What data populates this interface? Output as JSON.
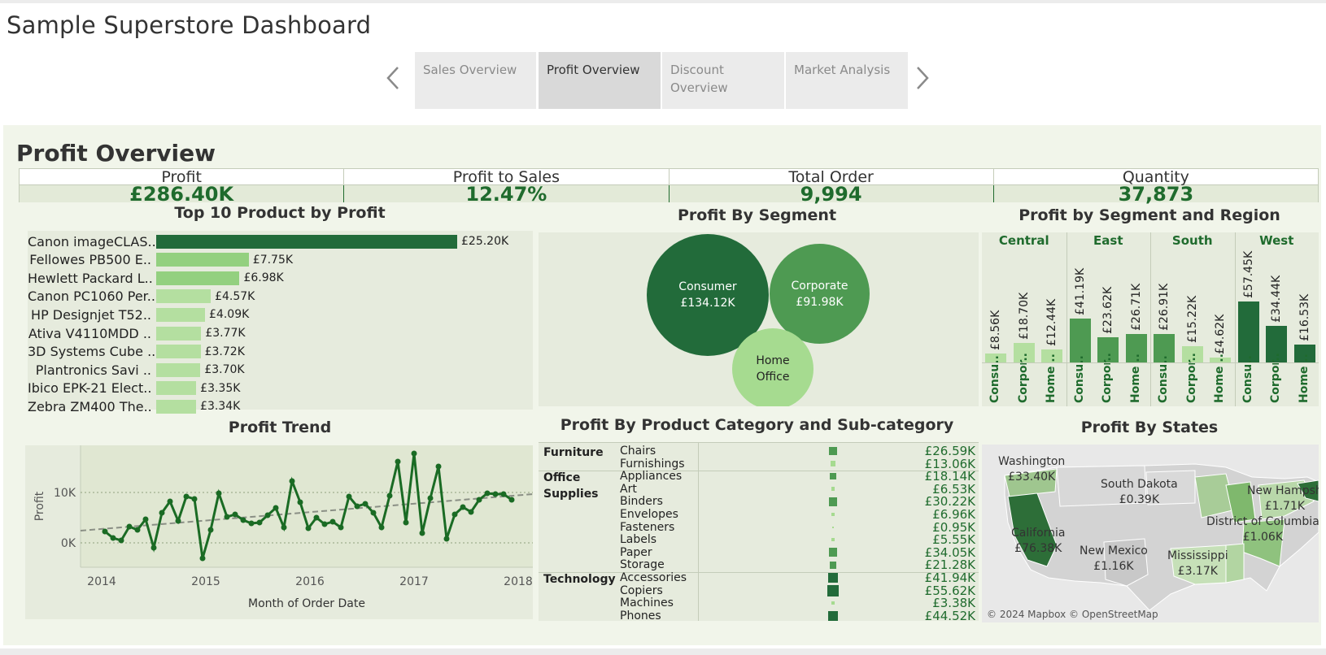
{
  "app": {
    "title": "Sample Superstore Dashboard"
  },
  "nav": {
    "prev_icon": "chevron-left-icon",
    "next_icon": "chevron-right-icon",
    "tabs": [
      {
        "label": "Sales Overview",
        "active": false
      },
      {
        "label": "Profit Overview",
        "active": true
      },
      {
        "label": "Discount Overview",
        "active": false
      },
      {
        "label": "Market Analysis",
        "active": false
      }
    ]
  },
  "dashboard": {
    "title": "Profit Overview",
    "colors": {
      "dark_green": "#226b3a",
      "mid_green": "#4e9a52",
      "light_green": "#93d07f",
      "pale_green": "#b4dfa0",
      "panel_bg": "#e6ebdd",
      "text_green": "#1f6b2d"
    },
    "kpis": [
      {
        "label": "Profit",
        "value": "£286.40K"
      },
      {
        "label": "Profit to Sales",
        "value": "12.47%"
      },
      {
        "label": "Total Order",
        "value": "9,994"
      },
      {
        "label": "Quantity",
        "value": "37,873"
      }
    ]
  },
  "top_products": {
    "title": "Top 10 Product by Profit",
    "items": [
      {
        "label": "Canon imageCLAS..",
        "value": 25.2,
        "display": "£25.20K"
      },
      {
        "label": "Fellowes PB500 E..",
        "value": 7.75,
        "display": "£7.75K"
      },
      {
        "label": "Hewlett Packard L..",
        "value": 6.98,
        "display": "£6.98K"
      },
      {
        "label": "Canon PC1060 Per..",
        "value": 4.57,
        "display": "£4.57K"
      },
      {
        "label": "HP Designjet T52..",
        "value": 4.09,
        "display": "£4.09K"
      },
      {
        "label": "Ativa V4110MDD ..",
        "value": 3.77,
        "display": "£3.77K"
      },
      {
        "label": "3D Systems Cube ..",
        "value": 3.72,
        "display": "£3.72K"
      },
      {
        "label": "Plantronics Savi ..",
        "value": 3.7,
        "display": "£3.70K"
      },
      {
        "label": "Ibico EPK-21 Elect..",
        "value": 3.35,
        "display": "£3.35K"
      },
      {
        "label": "Zebra ZM400 The..",
        "value": 3.34,
        "display": "£3.34K"
      }
    ]
  },
  "segments": {
    "title": "Profit By Segment",
    "items": [
      {
        "name": "Consumer",
        "value": "£134.12K"
      },
      {
        "name": "Corporate",
        "value": "£91.98K"
      },
      {
        "name": "Home",
        "name2": "Office"
      }
    ]
  },
  "segment_region": {
    "title": "Profit by Segment and Region",
    "regions": [
      {
        "name": "Central",
        "bars": [
          {
            "label": "Consu..",
            "value": 8.56,
            "display": "£8.56K"
          },
          {
            "label": "Corpor..",
            "value": 18.7,
            "display": "£18.70K"
          },
          {
            "label": "Home ..",
            "value": 12.44,
            "display": "£12.44K"
          }
        ]
      },
      {
        "name": "East",
        "bars": [
          {
            "label": "Consu..",
            "value": 41.19,
            "display": "£41.19K"
          },
          {
            "label": "Corpor..",
            "value": 23.62,
            "display": "£23.62K"
          },
          {
            "label": "Home ..",
            "value": 26.71,
            "display": "£26.71K"
          }
        ]
      },
      {
        "name": "South",
        "bars": [
          {
            "label": "Consu..",
            "value": 26.91,
            "display": "£26.91K"
          },
          {
            "label": "Corpor..",
            "value": 15.22,
            "display": "£15.22K"
          },
          {
            "label": "Home ..",
            "value": 4.62,
            "display": "£4.62K"
          }
        ]
      },
      {
        "name": "West",
        "bars": [
          {
            "label": "Consu..",
            "value": 57.45,
            "display": "£57.45K"
          },
          {
            "label": "Corpor..",
            "value": 34.44,
            "display": "£34.44K"
          },
          {
            "label": "Home ..",
            "value": 16.53,
            "display": "£16.53K"
          }
        ]
      }
    ]
  },
  "trend": {
    "title": "Profit Trend",
    "ylabel": "Profit",
    "xlabel": "Month of Order Date",
    "y_ticks": [
      "10K",
      "0K"
    ],
    "x_ticks": [
      "2014",
      "2015",
      "2016",
      "2017",
      "2018"
    ]
  },
  "category": {
    "title": "Profit By Product Category and Sub-category",
    "groups": [
      {
        "name": "Furniture",
        "subs": [
          {
            "name": "Chairs",
            "value": 26.59,
            "display": "£26.59K"
          },
          {
            "name": "Furnishings",
            "value": 13.06,
            "display": "£13.06K"
          }
        ]
      },
      {
        "name": "Office",
        "name2": "Supplies",
        "subs": [
          {
            "name": "Appliances",
            "value": 18.14,
            "display": "£18.14K"
          },
          {
            "name": "Art",
            "value": 6.53,
            "display": "£6.53K"
          },
          {
            "name": "Binders",
            "value": 30.22,
            "display": "£30.22K"
          },
          {
            "name": "Envelopes",
            "value": 6.96,
            "display": "£6.96K"
          },
          {
            "name": "Fasteners",
            "value": 0.95,
            "display": "£0.95K"
          },
          {
            "name": "Labels",
            "value": 5.55,
            "display": "£5.55K"
          },
          {
            "name": "Paper",
            "value": 34.05,
            "display": "£34.05K"
          },
          {
            "name": "Storage",
            "value": 21.28,
            "display": "£21.28K"
          }
        ]
      },
      {
        "name": "Technology",
        "subs": [
          {
            "name": "Accessories",
            "value": 41.94,
            "display": "£41.94K"
          },
          {
            "name": "Copiers",
            "value": 55.62,
            "display": "£55.62K"
          },
          {
            "name": "Machines",
            "value": 3.38,
            "display": "£3.38K"
          },
          {
            "name": "Phones",
            "value": 44.52,
            "display": "£44.52K"
          }
        ]
      }
    ]
  },
  "states": {
    "title": "Profit By States",
    "labels": [
      {
        "state": "Washington",
        "value": "£33.40K"
      },
      {
        "state": "South Dakota",
        "value": "£0.39K"
      },
      {
        "state": "New Hampsh",
        "value": "£1.71K"
      },
      {
        "state": "District of Columbia",
        "value": "£1.06K"
      },
      {
        "state": "California",
        "value": "£76.38K"
      },
      {
        "state": "New Mexico",
        "value": "£1.16K"
      },
      {
        "state": "Mississippi",
        "value": "£3.17K"
      }
    ],
    "credit": "© 2024 Mapbox © OpenStreetMap"
  }
}
